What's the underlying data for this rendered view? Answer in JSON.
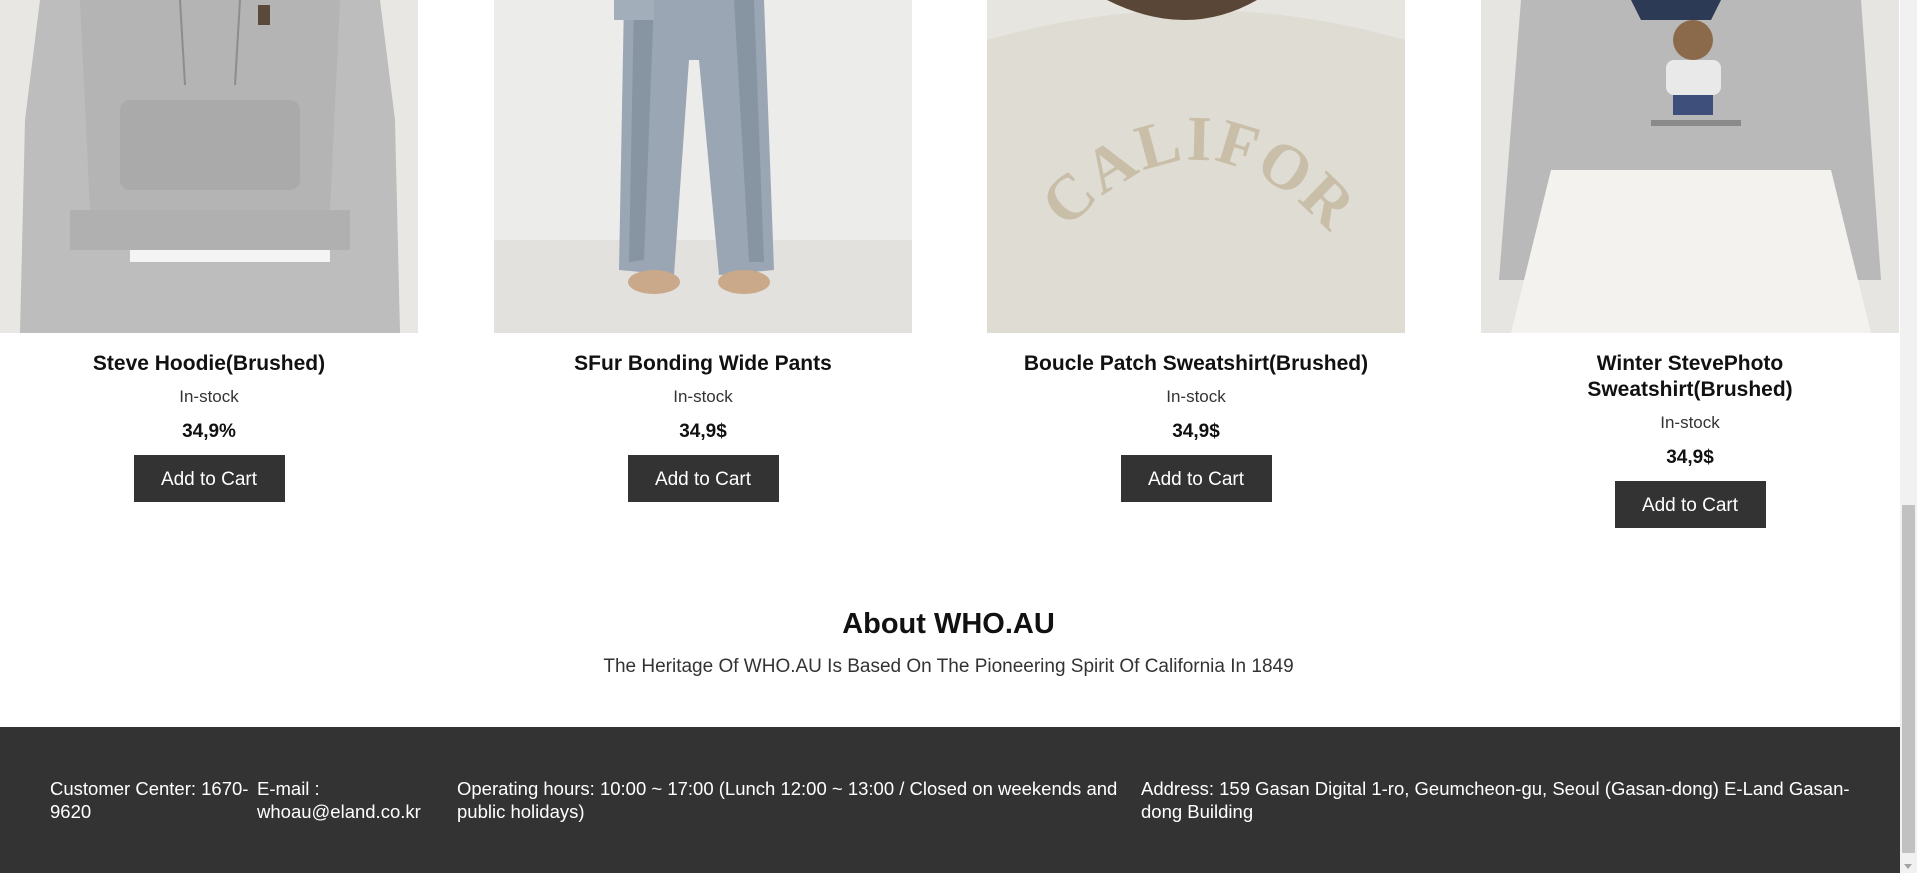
{
  "products": [
    {
      "name": "Steve Hoodie(Brushed)",
      "stock": "In-stock",
      "price": "34,9%",
      "cart": "Add to Cart"
    },
    {
      "name": "SFur Bonding Wide Pants",
      "stock": "In-stock",
      "price": "34,9$",
      "cart": "Add to Cart"
    },
    {
      "name": "Boucle Patch Sweatshirt(Brushed)",
      "stock": "In-stock",
      "price": "34,9$",
      "cart": "Add to Cart"
    },
    {
      "name": "Winter StevePhoto Sweatshirt(Brushed)",
      "stock": "In-stock",
      "price": "34,9$",
      "cart": "Add to Cart"
    }
  ],
  "image_text": {
    "sweatshirt_graphic": "CALIFORNIA"
  },
  "about": {
    "title": "About WHO.AU",
    "text": "The Heritage Of WHO.AU Is Based On The Pioneering Spirit Of California In 1849"
  },
  "footer": {
    "customer_center": "Customer Center: 1670-9620",
    "email": "E-mail : whoau@eland.co.kr",
    "hours": "Operating hours: 10:00 ~ 17:00 (Lunch 12:00 ~ 13:00 / Closed on weekends and public holidays)",
    "address": "Address: 159 Gasan Digital 1-ro, Geumcheon-gu, Seoul (Gasan-dong) E-Land Gasan-dong Building"
  },
  "colors": {
    "dark": "#333333",
    "background": "#ffffff",
    "image_bg": "#e9e8e4"
  }
}
